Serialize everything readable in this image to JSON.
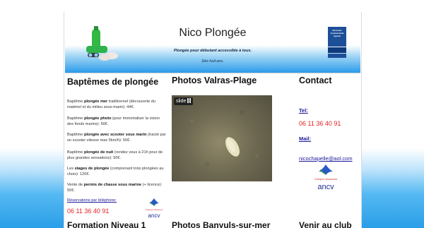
{
  "header": {
    "site_title": "Nico Plongée",
    "tagline": "Plongée pour débutant accessible à tous.",
    "age_note": "Dès huit ans.",
    "diving_logo_text": "Directeur Commerciale Agréée"
  },
  "left": {
    "title": "Baptêmes de plongée",
    "offers": [
      {
        "prefix": "Baptême ",
        "bold": "plongée mer",
        "suffix": " traditionnel (découverte du matériel et du milieu sous-marin): 44€."
      },
      {
        "prefix": "Baptême ",
        "bold": "plongée photo",
        "suffix": " (pour immortaliser la vision des fonds marins): 50€."
      },
      {
        "prefix": "Baptême ",
        "bold": "plongée avec scooter sous marin",
        "suffix": " (tracté par un scooter vitesse max 5km/h): 50€."
      },
      {
        "prefix": "Baptême ",
        "bold": "plongée de nuit",
        "suffix": " (rendez vous à 21h pour de plus grandes sensations): 50€."
      },
      {
        "prefix": "Les ",
        "bold": "stages de plongée",
        "suffix": " (comprenant trois plongées au choix): 120€."
      },
      {
        "prefix": "Vente de ",
        "bold": "permis de chasse sous marine",
        "suffix": " (+ licence): 50€."
      }
    ],
    "reservation_link": "Réservations par téléphone:",
    "phone": "06 11 36 40 91"
  },
  "middle": {
    "title": "Photos Valras-Plage",
    "slide_label": "slide"
  },
  "right": {
    "title": "Contact",
    "tel_label": "Tel:",
    "phone": "06 11 36 40 91",
    "mail_label": "Mail:",
    "email": "nicochapelle@aol.com"
  },
  "ancv": {
    "brand": "ancv",
    "tag": "Chèque-Vacances"
  },
  "bottom_headings": [
    "Formation Niveau 1",
    "Photos Banyuls-sur-mer",
    "Venir au club"
  ],
  "colors": {
    "accent_blue": "#2b9bea",
    "phone_red": "#e21f1f",
    "link_blue": "#1a1a99",
    "ancv_blue": "#1f2f8f"
  }
}
